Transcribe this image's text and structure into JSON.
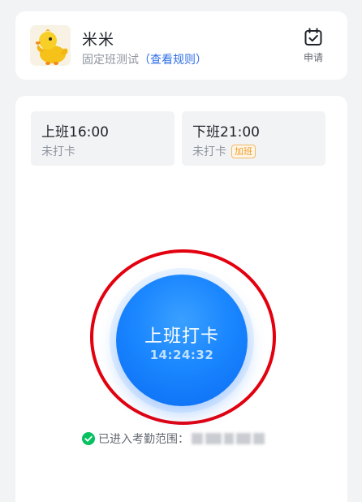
{
  "header": {
    "user_name": "米米",
    "group_name": "固定班测试",
    "rule_link": "（查看规则）",
    "apply_label": "申请",
    "icons": {
      "avatar": "duck-avatar",
      "apply": "calendar-check-icon"
    }
  },
  "shifts": [
    {
      "title": "上班16:00",
      "status": "未打卡"
    },
    {
      "title": "下班21:00",
      "status": "未打卡",
      "badge": "加班"
    }
  ],
  "punch": {
    "label": "上班打卡",
    "time": "14:24:32"
  },
  "location": {
    "status": "已进入考勤范围：",
    "icon": "check-circle-icon",
    "status_color": "#07c160"
  },
  "colors": {
    "accent": "#1a86ff",
    "link": "#2f6fe4",
    "highlight_ring": "#e3000f",
    "badge": "#ef9a25"
  }
}
